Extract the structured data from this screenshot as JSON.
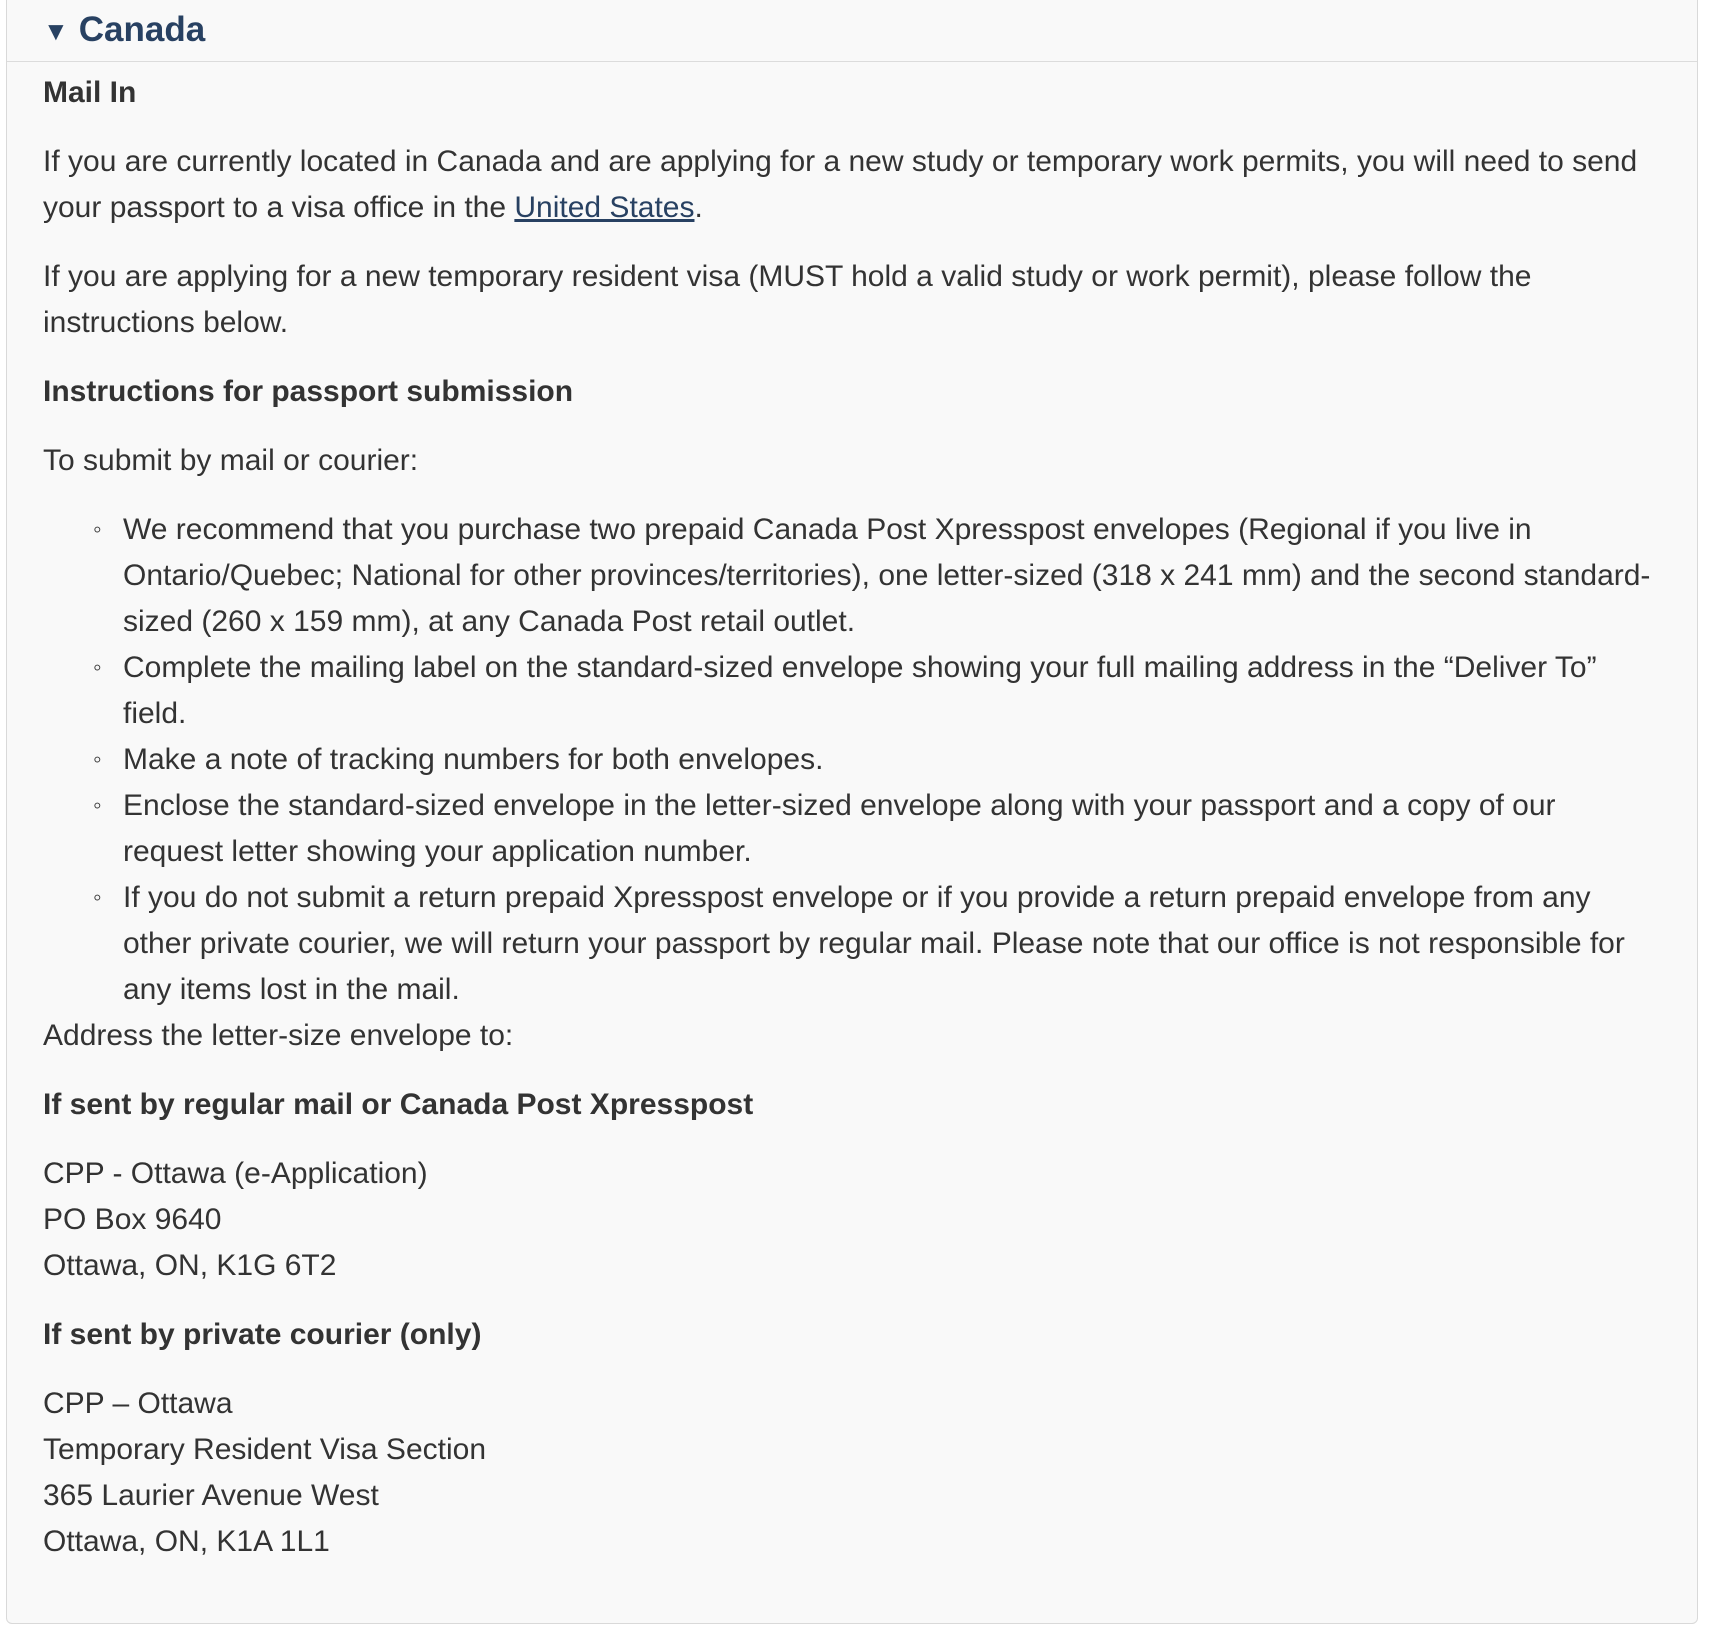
{
  "section": {
    "caret": "▼",
    "title": "Canada"
  },
  "mail_in": {
    "heading": "Mail In",
    "para1_before_link": "If you are currently located in Canada and are applying for a new study or temporary work permits, you will need to send your passport to a visa office in the ",
    "para1_link": "United States",
    "para1_after_link": ".",
    "para2": "If you are applying for a new temporary resident visa (MUST hold a valid study or work permit), please follow the instructions below."
  },
  "instructions": {
    "heading": "Instructions for passport submission",
    "intro": "To submit by mail or courier:",
    "steps": [
      "We recommend that you purchase two prepaid Canada Post Xpresspost envelopes (Regional if you live in Ontario/Quebec; National for other provinces/territories), one letter-sized (318 x 241 mm) and the second standard-sized (260 x 159 mm), at any Canada Post retail outlet.",
      "Complete the mailing label on the standard-sized envelope showing your full mailing address in the “Deliver To” field.",
      "Make a note of tracking numbers for both envelopes.",
      "Enclose the standard-sized envelope in the letter-sized envelope along with your passport and a copy of our request letter showing your application number.",
      "If you do not submit a return prepaid Xpresspost envelope or if you provide a return prepaid envelope from any other private courier, we will return your passport by regular mail. Please note that our office is not responsible for any items lost in the mail."
    ],
    "address_intro": "Address the letter-size envelope to:"
  },
  "regular_mail": {
    "heading": "If sent by regular mail or Canada Post Xpresspost",
    "lines": [
      "CPP - Ottawa (e-Application)",
      "PO Box 9640",
      "Ottawa, ON, K1G 6T2"
    ]
  },
  "courier": {
    "heading": "If sent by private courier (only)",
    "lines": [
      "CPP – Ottawa",
      "Temporary Resident Visa Section",
      "365 Laurier Avenue West",
      "Ottawa, ON, K1A 1L1"
    ]
  }
}
